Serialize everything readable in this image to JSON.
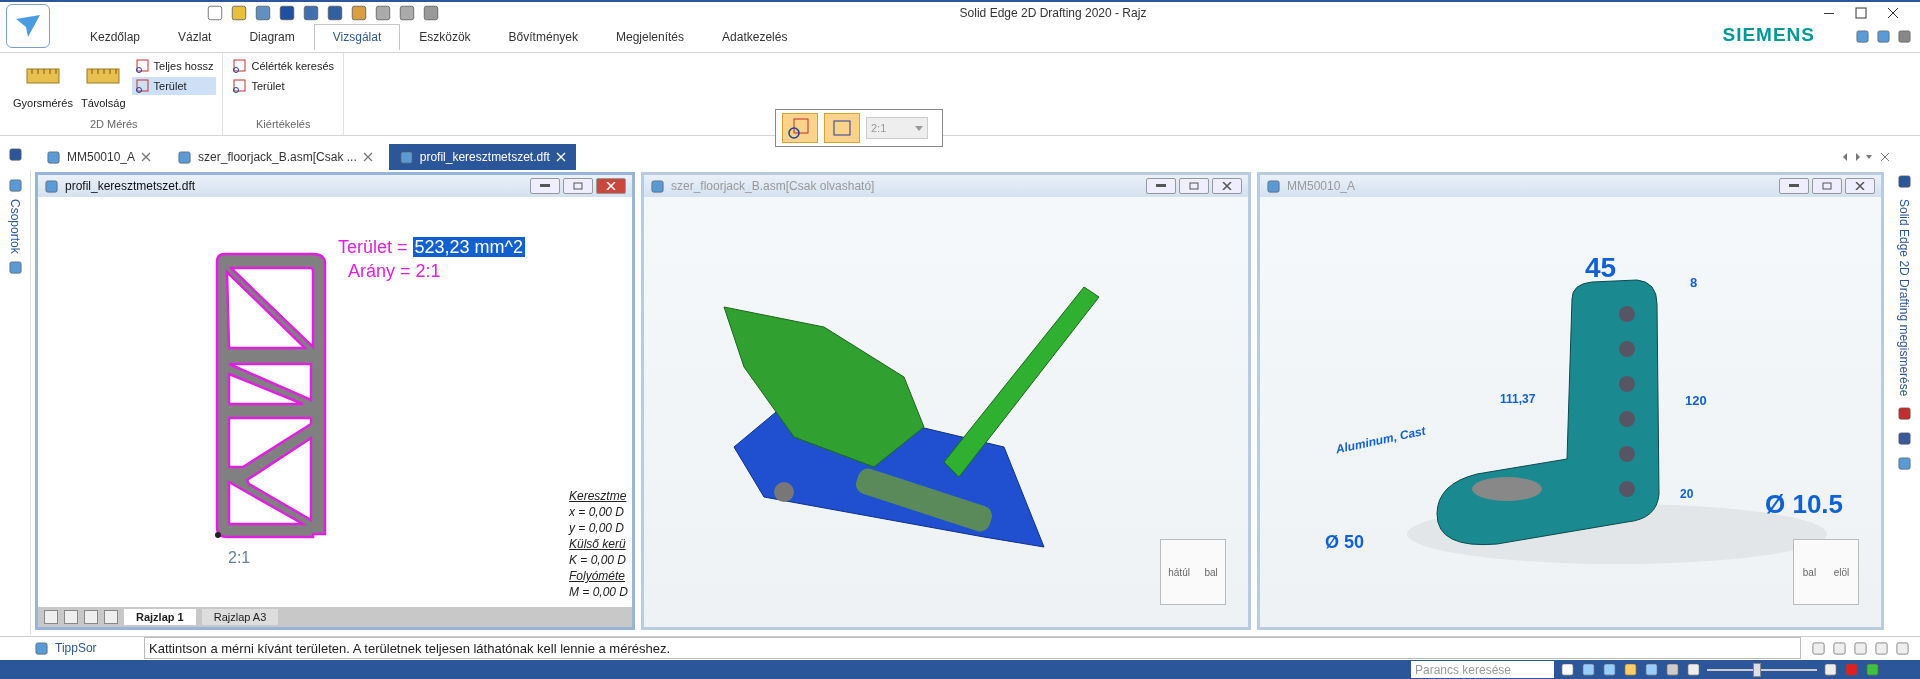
{
  "window": {
    "title": "Solid Edge 2D Drafting 2020 - Rajz",
    "brand": "SIEMENS"
  },
  "ribbon": {
    "tabs": [
      {
        "label": "Kezdőlap",
        "selected": false
      },
      {
        "label": "Vázlat",
        "selected": false
      },
      {
        "label": "Diagram",
        "selected": false
      },
      {
        "label": "Vizsgálat",
        "selected": true
      },
      {
        "label": "Eszközök",
        "selected": false
      },
      {
        "label": "Bővítmények",
        "selected": false
      },
      {
        "label": "Megjelenítés",
        "selected": false
      },
      {
        "label": "Adatkezelés",
        "selected": false
      }
    ],
    "groups": [
      {
        "label": "2D Mérés",
        "items": [
          {
            "kind": "large",
            "label": "Gyorsmérés",
            "selected": false
          },
          {
            "kind": "large",
            "label": "Távolság",
            "selected": false
          },
          {
            "kind": "small",
            "label": "Teljes hossz",
            "selected": false
          },
          {
            "kind": "small",
            "label": "Terület",
            "selected": true
          }
        ]
      },
      {
        "label": "Kiértékelés",
        "items": [
          {
            "kind": "small",
            "label": "Célérték keresés",
            "selected": false
          },
          {
            "kind": "small",
            "label": "Terület",
            "selected": false
          }
        ]
      }
    ]
  },
  "float_toolbar": {
    "scale": "2:1"
  },
  "doc_tabs": [
    {
      "label": "MM50010_A",
      "selected": false
    },
    {
      "label": "szer_floorjack_B.asm[Csak ...",
      "selected": false
    },
    {
      "label": "profil_keresztmetszet.dft",
      "selected": true
    }
  ],
  "sidebar": {
    "label": "Csoportok"
  },
  "panes": [
    {
      "kind": "drawing",
      "title": "profil_keresztmetszet.dft",
      "active": true,
      "area_label": "Terület = ",
      "area_value": "523,23 mm^2",
      "ratio": "Arány = 2:1",
      "scale_label": "2:1",
      "props": [
        "Keresztme",
        "x = 0,00 D",
        "y = 0,00 D",
        "Külső kerü",
        "K = 0,00 D",
        "Folyóméte",
        "M = 0,00 D"
      ],
      "sheets": [
        {
          "label": "Rajzlap 1",
          "selected": true
        },
        {
          "label": "Rajzlap A3",
          "selected": false
        }
      ]
    },
    {
      "kind": "jack",
      "title": "szer_floorjack_B.asm[Csak olvasható]",
      "active": false,
      "cube": [
        "hátúl",
        "bal"
      ]
    },
    {
      "kind": "bracket",
      "title": "MM50010_A",
      "active": false,
      "dims": [
        "45",
        "8",
        "120",
        "111,37",
        "Aluminum, Cast",
        "20",
        "Ø 10.5",
        "Ø 50"
      ],
      "cube": [
        "bal",
        "elöl"
      ]
    }
  ],
  "help_strip": {
    "label": "Solid Edge 2D Drafting megismerése"
  },
  "tip_bar": {
    "label": "TippSor",
    "text": "Kattintson a mérni kívánt területen.  A területnek teljesen láthatónak kell lennie a méréshez."
  },
  "status_bar": {
    "search_placeholder": "Parancs keresése",
    "zoom": {
      "level": 0.45
    }
  }
}
